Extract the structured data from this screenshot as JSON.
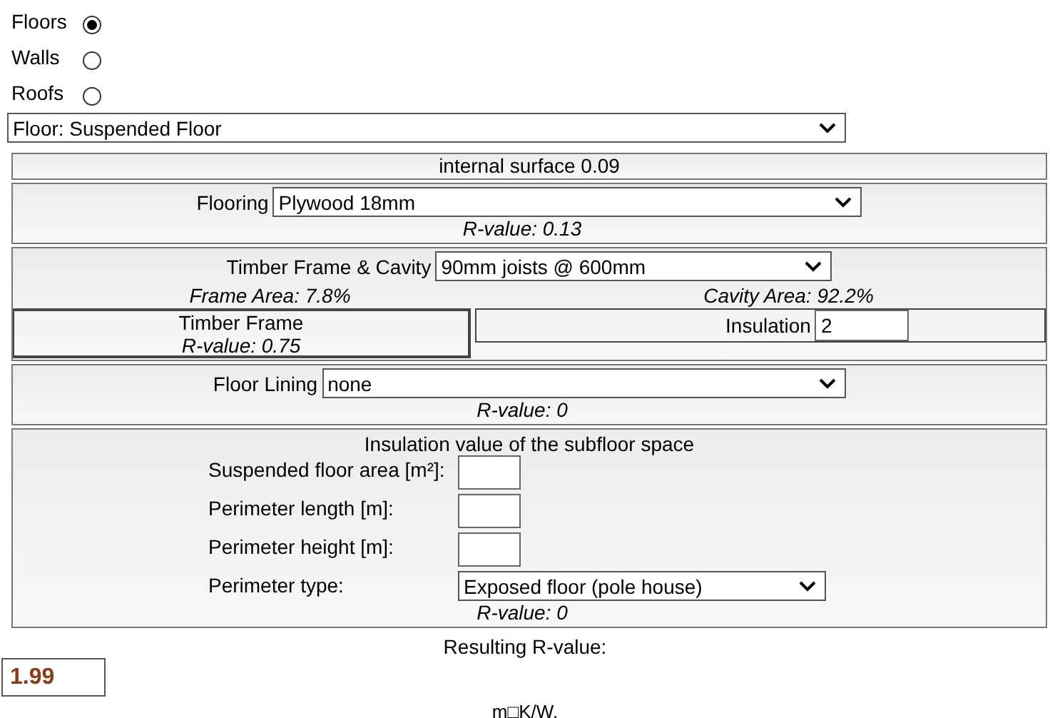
{
  "element_types": [
    {
      "label": "Floors",
      "selected": true
    },
    {
      "label": "Walls",
      "selected": false
    },
    {
      "label": "Roofs",
      "selected": false
    }
  ],
  "type_select": {
    "value": "Floor: Suspended Floor"
  },
  "internal_surface": "internal surface 0.09",
  "flooring": {
    "label": "Flooring",
    "value": "Plywood 18mm",
    "r_value": "R-value: 0.13"
  },
  "timber": {
    "label": "Timber Frame & Cavity",
    "value": "90mm joists @ 600mm",
    "frame_area": "Frame Area: 7.8%",
    "cavity_area": "Cavity Area: 92.2%",
    "frame_title": "Timber Frame",
    "frame_r_value": "R-value: 0.75",
    "insulation_label": "Insulation",
    "insulation_value": "2"
  },
  "lining": {
    "label": "Floor Lining",
    "value": "none",
    "r_value": "R-value: 0"
  },
  "subfloor": {
    "title": "Insulation value of the subfloor space",
    "fields": [
      {
        "kind": "input",
        "label": "Suspended floor area [m²]:"
      },
      {
        "kind": "input",
        "label": "Perimeter length [m]:"
      },
      {
        "kind": "input",
        "label": "Perimeter height [m]:"
      },
      {
        "kind": "select",
        "label": "Perimeter type:",
        "value": "Exposed floor (pole house)"
      }
    ],
    "r_value": "R-value: 0"
  },
  "result": {
    "label": "Resulting R-value:",
    "value": "1.99",
    "unit": "m□K/W."
  }
}
